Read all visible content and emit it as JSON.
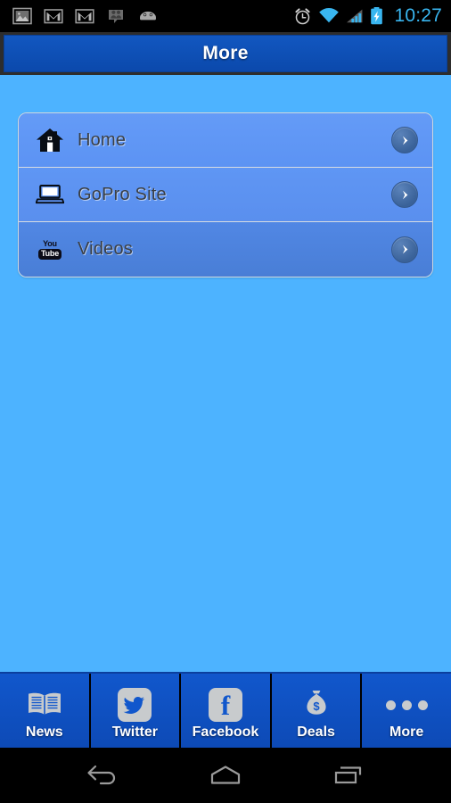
{
  "status_bar": {
    "time": "10:27",
    "left_icons": [
      {
        "name": "gallery-photo-icon"
      },
      {
        "name": "gmail-icon"
      },
      {
        "name": "gmail-icon"
      },
      {
        "name": "messaging-people-icon"
      },
      {
        "name": "android-head-icon"
      }
    ],
    "right_icons": [
      {
        "name": "alarm-clock-icon"
      },
      {
        "name": "wifi-signal-icon"
      },
      {
        "name": "cellular-signal-icon"
      },
      {
        "name": "battery-charging-icon"
      }
    ],
    "time_color": "#39b6f0",
    "background": "#000000"
  },
  "title_bar": {
    "title": "More",
    "background": "#0f52bd",
    "text_color": "#ffffff"
  },
  "menu": {
    "items": [
      {
        "label": "Home",
        "icon": "house-icon",
        "arrow": "chevron-right-icon"
      },
      {
        "label": "GoPro Site",
        "icon": "laptop-icon",
        "arrow": "chevron-right-icon"
      },
      {
        "label": "Videos",
        "icon": "youtube-icon",
        "arrow": "chevron-right-icon"
      }
    ],
    "row_colors": [
      "#5e96f5",
      "#5d94f2",
      "#4d83de"
    ],
    "text_color": "#3a3f45",
    "arrow_color": "#3a6299"
  },
  "page": {
    "background": "#4db3ff"
  },
  "tab_bar": {
    "background": "#0d4fc4",
    "active_tab": "More",
    "tabs": [
      {
        "label": "News",
        "icon": "open-book-icon"
      },
      {
        "label": "Twitter",
        "icon": "twitter-bird-icon"
      },
      {
        "label": "Facebook",
        "icon": "facebook-f-icon"
      },
      {
        "label": "Deals",
        "icon": "money-bag-icon"
      },
      {
        "label": "More",
        "icon": "three-dots-icon"
      }
    ]
  },
  "nav_bar": {
    "buttons": [
      {
        "name": "back-button",
        "icon": "back-arrow-icon"
      },
      {
        "name": "home-button",
        "icon": "home-pentagon-icon"
      },
      {
        "name": "recent-apps-button",
        "icon": "recent-apps-icon"
      }
    ],
    "background": "#000000"
  }
}
